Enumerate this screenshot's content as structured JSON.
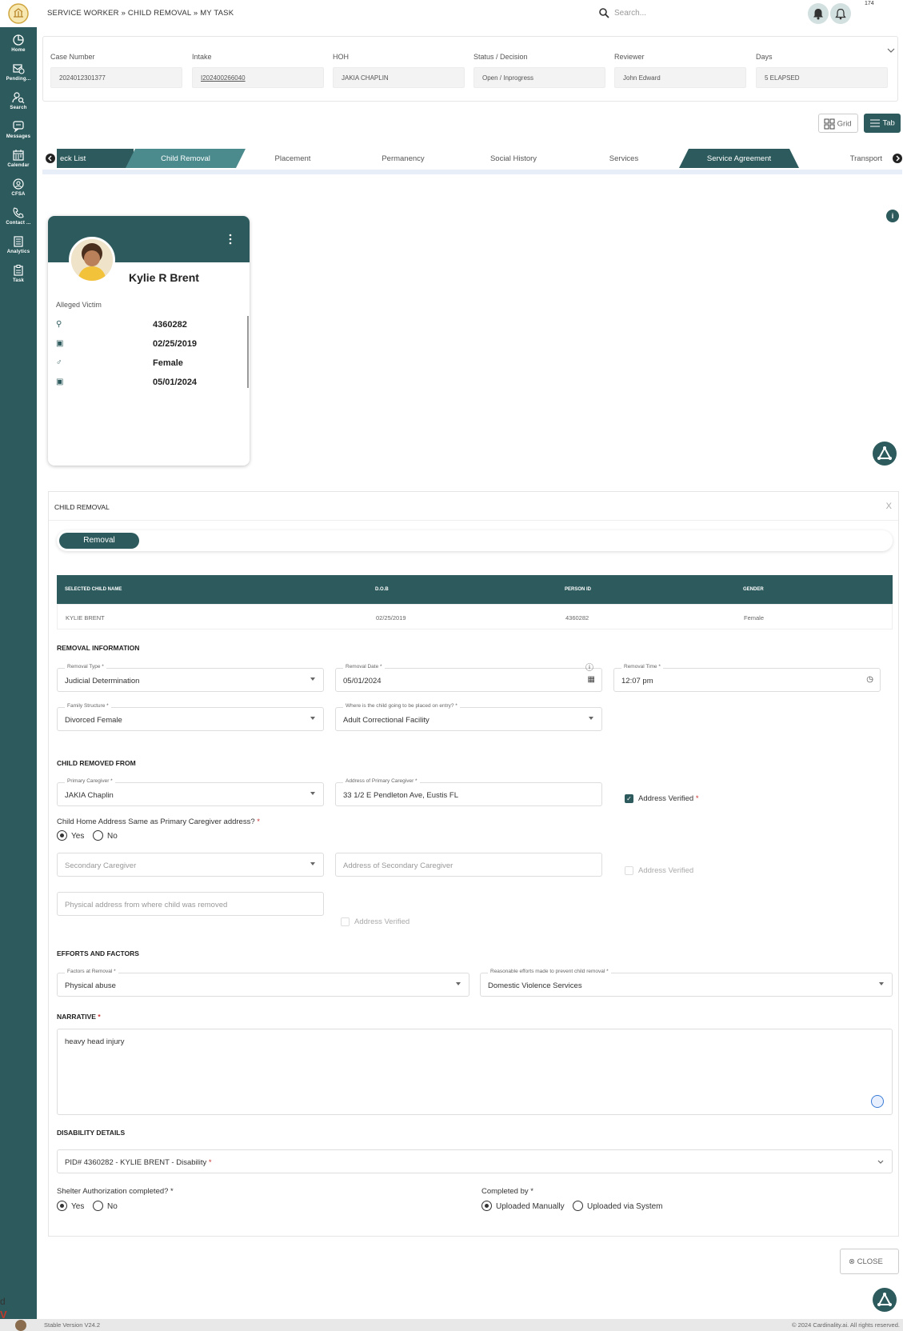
{
  "header": {
    "breadcrumb": "SERVICE WORKER  »  CHILD REMOVAL  »  MY TASK",
    "search_placeholder": "Search...",
    "notification_count": "174"
  },
  "sidebar": {
    "items": [
      {
        "label": "Home",
        "icon": "home-pie-icon"
      },
      {
        "label": "Pending...",
        "icon": "pending-icon"
      },
      {
        "label": "Search",
        "icon": "search-person-icon"
      },
      {
        "label": "Messages",
        "icon": "message-icon"
      },
      {
        "label": "Calendar",
        "icon": "calendar-icon"
      },
      {
        "label": "CFSA",
        "icon": "cfsa-icon"
      },
      {
        "label": "Contact ...",
        "icon": "phone-icon"
      },
      {
        "label": "Analytics",
        "icon": "analytics-icon"
      },
      {
        "label": "Task",
        "icon": "task-icon"
      }
    ]
  },
  "case": {
    "fields": [
      {
        "label": "Case Number",
        "value": "2024012301377"
      },
      {
        "label": "Intake",
        "value": "I202400266040"
      },
      {
        "label": "HOH",
        "value": "JAKIA CHAPLIN"
      },
      {
        "label": "Status / Decision",
        "value": "Open / Inprogress"
      },
      {
        "label": "Reviewer",
        "value": "John Edward"
      },
      {
        "label": "Days",
        "value": "5 ELAPSED"
      }
    ]
  },
  "view": {
    "grid_label": "Grid",
    "tab_label": "Tab"
  },
  "tabs": [
    "eck List",
    "Child Removal",
    "Placement",
    "Permanency",
    "Social History",
    "Services",
    "Service Agreement",
    "Transport"
  ],
  "person": {
    "name": "Kylie R Brent",
    "role": "Alleged Victim",
    "person_id": "4360282",
    "dob": "02/25/2019",
    "gender": "Female",
    "date": "05/01/2024"
  },
  "panel": {
    "title": "CHILD REMOVAL",
    "close_x": "X",
    "subtab": "Removal",
    "table": {
      "headers": [
        "SELECTED CHILD NAME",
        "D.O.B",
        "PERSON ID",
        "GENDER"
      ],
      "row": [
        "KYLIE BRENT",
        "02/25/2019",
        "4360282",
        "Female"
      ]
    },
    "removal_info": {
      "title": "REMOVAL INFORMATION",
      "removal_type_label": "Removal Type *",
      "removal_type": "Judicial Determination",
      "removal_date_label": "Removal Date *",
      "removal_date": "05/01/2024",
      "removal_time_label": "Removal Time *",
      "removal_time": "12:07 pm",
      "family_structure_label": "Family Structure *",
      "family_structure": "Divorced Female",
      "placement_label": "Where is the child going to be placed on entry? *",
      "placement": "Adult Correctional Facility"
    },
    "removed_from": {
      "title": "CHILD REMOVED FROM",
      "primary_label": "Primary Caregiver *",
      "primary": "JAKIA Chaplin",
      "primary_addr_label": "Address of Primary Caregiver *",
      "primary_addr": "33 1/2 E Pendleton Ave, Eustis FL",
      "verified_label": "Address Verified",
      "question": "Child Home Address Same as Primary Caregiver address?",
      "yes": "Yes",
      "no": "No",
      "secondary_placeholder": "Secondary Caregiver",
      "secondary_addr_placeholder": "Address of Secondary Caregiver",
      "verified_label2": "Address Verified",
      "physical_placeholder": "Physical address from where child was removed",
      "verified_label3": "Address Verified"
    },
    "efforts": {
      "title": "EFFORTS AND FACTORS",
      "factors_label": "Factors at Removal *",
      "factors": "Physical abuse",
      "reasonable_label": "Reasonable efforts made to prevent child removal *",
      "reasonable": "Domestic Violence Services"
    },
    "narrative": {
      "title": "NARRATIVE",
      "text": "heavy head  injury"
    },
    "disability": {
      "title": "DISABILITY DETAILS",
      "text": "PID# 4360282 - KYLIE BRENT - Disability"
    },
    "shelter": {
      "question": "Shelter Authorization completed? *",
      "yes": "Yes",
      "no": "No",
      "completed_label": "Completed by *",
      "manual": "Uploaded Manually",
      "system": "Uploaded via System"
    }
  },
  "close_button": "CLOSE",
  "footer": {
    "version": "Stable Version V24.2",
    "copyright": "© 2024 Cardinality.ai. All rights reserved.",
    "stray_text": "d",
    "stray_text2": "V"
  },
  "colors": {
    "primary": "#2d5a5c",
    "secondary": "#4b8b8e"
  }
}
